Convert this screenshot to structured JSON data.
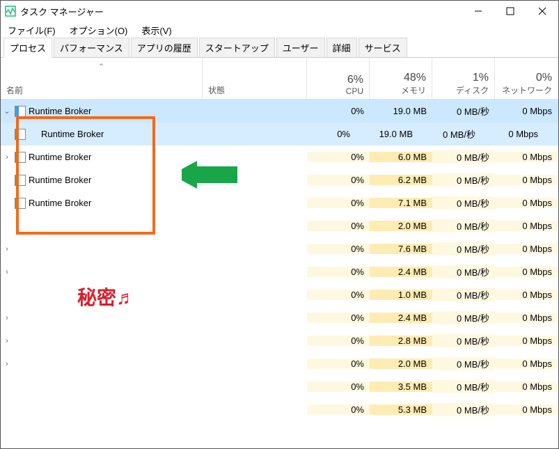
{
  "titlebar": {
    "title": "タスク マネージャー"
  },
  "menu": {
    "file": "ファイル(F)",
    "options": "オプション(O)",
    "view": "表示(V)"
  },
  "tabs": {
    "processes": "プロセス",
    "performance": "パフォーマンス",
    "history": "アプリの履歴",
    "startup": "スタートアップ",
    "users": "ユーザー",
    "details": "詳細",
    "services": "サービス"
  },
  "headers": {
    "name": "名前",
    "status": "状態",
    "cpu_pct": "6%",
    "cpu": "CPU",
    "mem_pct": "48%",
    "mem": "メモリ",
    "disk_pct": "1%",
    "disk": "ディスク",
    "net_pct": "0%",
    "net": "ネットワーク"
  },
  "rows": [
    {
      "chev": "⌄",
      "name": "Runtime Broker",
      "cpu": "0%",
      "mem": "19.0 MB",
      "disk": "0 MB/秒",
      "net": "0 Mbps",
      "cls": "sel",
      "icon": true
    },
    {
      "chev": "",
      "name": "Runtime Broker",
      "cpu": "0%",
      "mem": "19.0 MB",
      "disk": "0 MB/秒",
      "net": "0 Mbps",
      "cls": "selchild child",
      "icon": true
    },
    {
      "chev": "›",
      "name": "Runtime Broker",
      "cpu": "0%",
      "mem": "6.0 MB",
      "disk": "0 MB/秒",
      "net": "0 Mbps",
      "cls": "",
      "icon": true
    },
    {
      "chev": "",
      "name": "Runtime Broker",
      "cpu": "0%",
      "mem": "6.2 MB",
      "disk": "0 MB/秒",
      "net": "0 Mbps",
      "cls": "",
      "icon": true
    },
    {
      "chev": "",
      "name": "Runtime Broker",
      "cpu": "0%",
      "mem": "7.1 MB",
      "disk": "0 MB/秒",
      "net": "0 Mbps",
      "cls": "",
      "icon": true
    },
    {
      "chev": "",
      "name": "",
      "cpu": "0%",
      "mem": "2.0 MB",
      "disk": "0 MB/秒",
      "net": "0 Mbps",
      "cls": "",
      "icon": false
    },
    {
      "chev": "›",
      "name": "",
      "cpu": "0%",
      "mem": "7.6 MB",
      "disk": "0 MB/秒",
      "net": "0 Mbps",
      "cls": "",
      "icon": false
    },
    {
      "chev": "›",
      "name": "",
      "cpu": "0%",
      "mem": "2.4 MB",
      "disk": "0 MB/秒",
      "net": "0 Mbps",
      "cls": "",
      "icon": false
    },
    {
      "chev": "",
      "name": "",
      "cpu": "0%",
      "mem": "1.0 MB",
      "disk": "0 MB/秒",
      "net": "0 Mbps",
      "cls": "",
      "icon": false
    },
    {
      "chev": "›",
      "name": "",
      "cpu": "0%",
      "mem": "2.4 MB",
      "disk": "0 MB/秒",
      "net": "0 Mbps",
      "cls": "",
      "icon": false
    },
    {
      "chev": "›",
      "name": "",
      "cpu": "0%",
      "mem": "2.8 MB",
      "disk": "0 MB/秒",
      "net": "0 Mbps",
      "cls": "",
      "icon": false
    },
    {
      "chev": "›",
      "name": "",
      "cpu": "0%",
      "mem": "2.0 MB",
      "disk": "0 MB/秒",
      "net": "0 Mbps",
      "cls": "",
      "icon": false
    },
    {
      "chev": "",
      "name": "",
      "cpu": "0%",
      "mem": "3.5 MB",
      "disk": "0 MB/秒",
      "net": "0 Mbps",
      "cls": "",
      "icon": false
    },
    {
      "chev": "",
      "name": "",
      "cpu": "0%",
      "mem": "5.3 MB",
      "disk": "0 MB/秒",
      "net": "0 Mbps",
      "cls": "",
      "icon": false
    }
  ],
  "annotation": {
    "secret": "秘密♬"
  }
}
